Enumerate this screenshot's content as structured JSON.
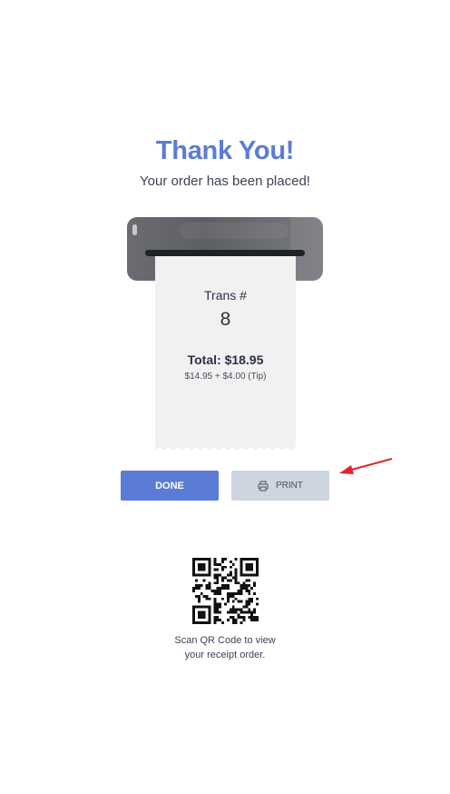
{
  "header": {
    "title": "Thank You!",
    "subtitle": "Your order has been placed!"
  },
  "receipt": {
    "trans_label": "Trans #",
    "trans_number": "8",
    "total": "Total: $18.95",
    "breakdown": "$14.95 + $4.00 (Tip)"
  },
  "actions": {
    "done_label": "DONE",
    "print_label": "PRINT",
    "print_icon": "printer-icon"
  },
  "qr": {
    "caption_line1": "Scan QR Code to view",
    "caption_line2": "your receipt order."
  },
  "colors": {
    "accent": "#5b7cd6",
    "print_button": "#cdd5e0",
    "annotation_arrow": "#e0242a"
  }
}
